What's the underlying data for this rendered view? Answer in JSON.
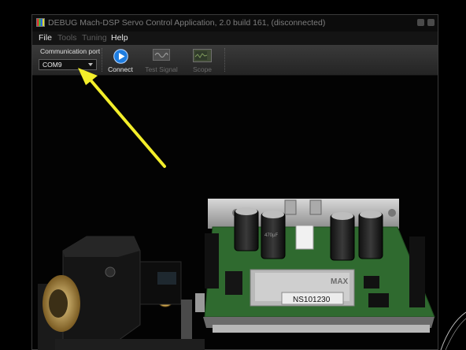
{
  "window": {
    "title": "DEBUG Mach-DSP Servo Control Application, 2.0 build 161, (disconnected)"
  },
  "menu": {
    "items": [
      {
        "label": "File",
        "enabled": true
      },
      {
        "label": "Tools",
        "enabled": false
      },
      {
        "label": "Tuning",
        "enabled": false
      },
      {
        "label": "Help",
        "enabled": true
      }
    ]
  },
  "toolbar": {
    "comm_port_label": "Communication port",
    "comm_port_value": "COM9",
    "connect_label": "Connect",
    "test_signal_label": "Test Signal",
    "scope_label": "Scope"
  },
  "photo": {
    "board_label": "NS101230",
    "chip_label": "MAX",
    "capacitor_label": "470µF"
  },
  "colors": {
    "annotation_arrow": "#f3ee2a",
    "pcb_green": "#2f6a2f",
    "connect_blue": "#1e7de0"
  }
}
